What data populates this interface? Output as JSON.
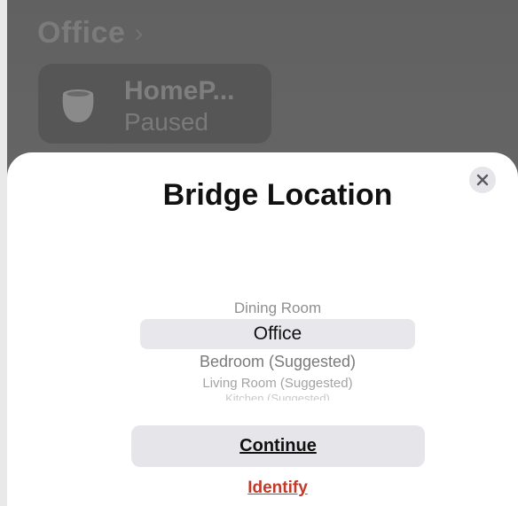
{
  "background": {
    "room_title": "Office",
    "accessory_tile": {
      "name": "HomeP...",
      "status": "Paused",
      "icon": "homepod-icon"
    }
  },
  "sheet": {
    "title": "Bridge Location",
    "close_icon": "close-icon",
    "room_picker": {
      "items": [
        "Dining Room",
        "Office",
        "Bedroom (Suggested)",
        "Living Room (Suggested)",
        "Kitchen (Suggested)"
      ],
      "selected": "Office"
    },
    "continue_label": "Continue",
    "identify_label": "Identify"
  },
  "colors": {
    "identify_red": "#c0392b",
    "button_gray": "#e6e6ea",
    "dim_backdrop": "#616161"
  }
}
